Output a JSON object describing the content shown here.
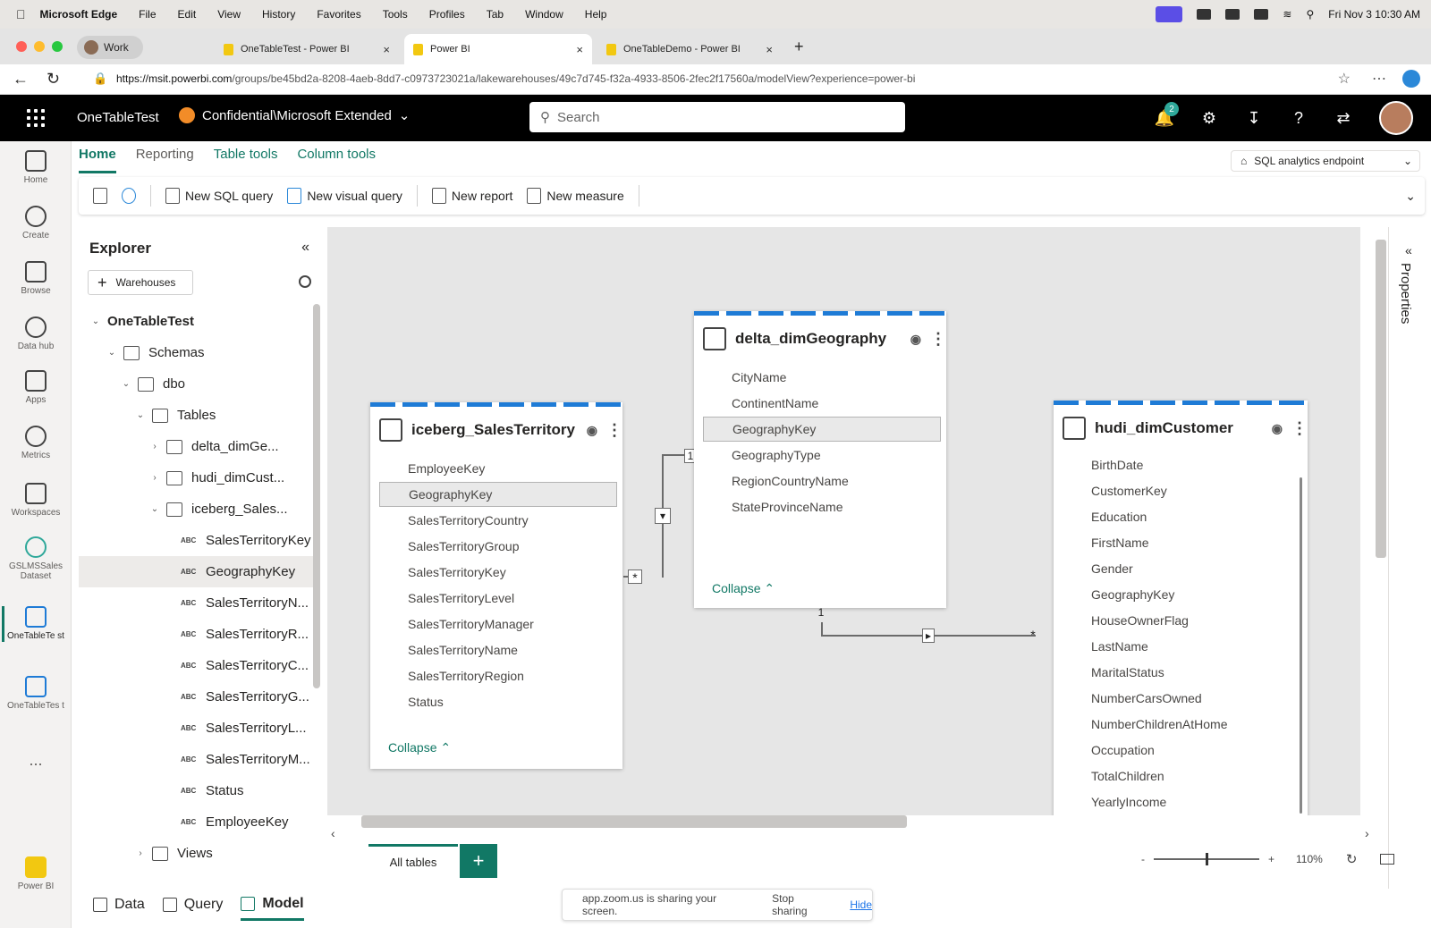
{
  "mac_menu": {
    "items": [
      "Microsoft Edge",
      "File",
      "Edit",
      "View",
      "History",
      "Favorites",
      "Tools",
      "Profiles",
      "Tab",
      "Window",
      "Help"
    ],
    "clock": "Fri Nov 3  10:30 AM"
  },
  "browser": {
    "profile": "Work",
    "tabs": [
      {
        "title": "OneTableTest - Power BI",
        "active": false
      },
      {
        "title": "Power BI",
        "active": true
      },
      {
        "title": "OneTableDemo - Power BI",
        "active": false
      }
    ],
    "url_host": "https://msit.powerbi.com",
    "url_path": "/groups/be45bd2a-8208-4aeb-8dd7-c0973723021a/lakewarehouses/49c7d745-f32a-4933-8506-2fec2f17560a/modelView?experience=power-bi"
  },
  "header": {
    "workspace": "OneTableTest",
    "sensitivity": "Confidential\\Microsoft Extended",
    "search_placeholder": "Search",
    "notif_count": "2"
  },
  "rail": {
    "items": [
      "Home",
      "Create",
      "Browse",
      "Data hub",
      "Apps",
      "Metrics",
      "Workspaces",
      "GSLMSSales Dataset",
      "OneTableTe st",
      "OneTableTes t",
      "...",
      "Power BI"
    ]
  },
  "ribbon": {
    "tabs": [
      "Home",
      "Reporting",
      "Table tools",
      "Column tools"
    ],
    "endpoint": "SQL analytics endpoint",
    "buttons": [
      "New SQL query",
      "New visual query",
      "New report",
      "New measure"
    ]
  },
  "explorer": {
    "title": "Explorer",
    "warehouses_btn": "Warehouses",
    "root": "OneTableTest",
    "schemas": "Schemas",
    "dbo": "dbo",
    "tables": "Tables",
    "table_items": [
      "delta_dimGe...",
      "hudi_dimCust...",
      "iceberg_Sales..."
    ],
    "columns": [
      "SalesTerritoryKey",
      "GeographyKey",
      "SalesTerritoryN...",
      "SalesTerritoryR...",
      "SalesTerritoryC...",
      "SalesTerritoryG...",
      "SalesTerritoryL...",
      "SalesTerritoryM...",
      "Status",
      "EmployeeKey"
    ],
    "views": "Views",
    "abc": "ABC"
  },
  "cards": {
    "iceberg": {
      "title": "iceberg_SalesTerritory",
      "fields": [
        "EmployeeKey",
        "GeographyKey",
        "SalesTerritoryCountry",
        "SalesTerritoryGroup",
        "SalesTerritoryKey",
        "SalesTerritoryLevel",
        "SalesTerritoryManager",
        "SalesTerritoryName",
        "SalesTerritoryRegion",
        "Status"
      ],
      "collapse": "Collapse"
    },
    "delta": {
      "title": "delta_dimGeography",
      "fields": [
        "CityName",
        "ContinentName",
        "GeographyKey",
        "GeographyType",
        "RegionCountryName",
        "StateProvinceName"
      ],
      "collapse": "Collapse"
    },
    "hudi": {
      "title": "hudi_dimCustomer",
      "fields": [
        "BirthDate",
        "CustomerKey",
        "Education",
        "FirstName",
        "Gender",
        "GeographyKey",
        "HouseOwnerFlag",
        "LastName",
        "MaritalStatus",
        "NumberCarsOwned",
        "NumberChildrenAtHome",
        "Occupation",
        "TotalChildren",
        "YearlyIncome"
      ]
    }
  },
  "relationships": {
    "one": "1",
    "many": "*"
  },
  "properties_label": "Properties",
  "bottom": {
    "all_tables": "All tables",
    "add": "+",
    "zoom": "110%",
    "views": [
      "Data",
      "Query",
      "Model"
    ],
    "share_msg": "app.zoom.us is sharing your screen.",
    "stop": "Stop sharing",
    "hide": "Hide"
  },
  "colors": {
    "accent": "#117865",
    "stripe": "#1e7bd6",
    "header_bg": "#000000"
  }
}
